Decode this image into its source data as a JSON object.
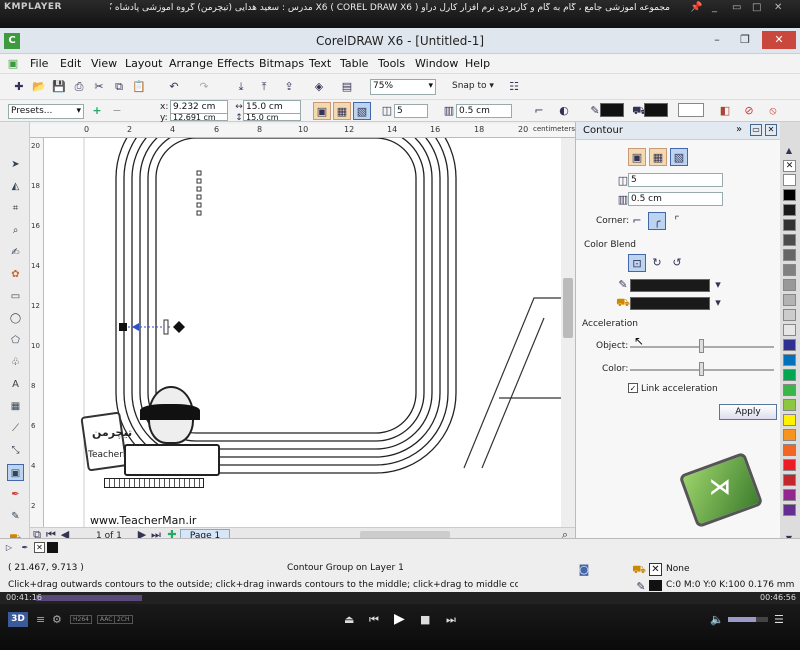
{
  "kmplayer": {
    "logo": "KMPLAYER",
    "title": "مجموعه آموزشی جامع ، گام به گام و کاربردی نرم افزار کارل دراو X6 ( COREL DRAW X6 ) مدرس : سعید هدایی (تیچرمن) گروه آموزشی پادشاه گرافیست ها",
    "time_elapsed": "00:41:16",
    "time_total": "00:46:56",
    "progress_fraction": 0.88,
    "badges": [
      "3D",
      "H264",
      "AAC",
      "2CH"
    ]
  },
  "app": {
    "title": "CorelDRAW X6 - [Untitled-1]",
    "window_buttons": [
      "–",
      "❐",
      "✕"
    ]
  },
  "menu": [
    "File",
    "Edit",
    "View",
    "Layout",
    "Arrange",
    "Effects",
    "Bitmaps",
    "Text",
    "Table",
    "Tools",
    "Window",
    "Help"
  ],
  "standard_toolbar": {
    "zoom": "75%",
    "snap_to": "Snap to"
  },
  "property_bar": {
    "presets": "Presets...",
    "x_label": "x:",
    "x": "9.232 cm",
    "y_label": "y:",
    "y": "12.691 cm",
    "width": "15.0 cm",
    "height": "15.0 cm",
    "steps": "5",
    "offset": "0.5 cm"
  },
  "ruler": {
    "top_ticks": [
      "0",
      "2",
      "4",
      "6",
      "8",
      "10",
      "12",
      "14",
      "16",
      "18",
      "20"
    ],
    "left_ticks": [
      "20",
      "18",
      "16",
      "14",
      "12",
      "10",
      "8",
      "6",
      "4",
      "2"
    ],
    "unit": "centimeters"
  },
  "canvas": {
    "watermark_brand": "TeacherMan",
    "watermark_brand_fa": "تیچرمن",
    "watermark_url": "www.TeacherMan.ir"
  },
  "page_nav": {
    "page_count": "1 of 1",
    "page_tab": "Page 1"
  },
  "docker": {
    "title": "Contour",
    "steps": "5",
    "offset": "0.5 cm",
    "corner_label": "Corner:",
    "color_blend_label": "Color Blend",
    "acceleration_label": "Acceleration",
    "object_label": "Object:",
    "color_label": "Color:",
    "link_acceleration": "Link acceleration",
    "link_acceleration_checked": true,
    "apply": "Apply"
  },
  "palette_colors": [
    "#ffffff",
    "#000000",
    "#1a1a1a",
    "#333333",
    "#4d4d4d",
    "#666666",
    "#808080",
    "#999999",
    "#b3b3b3",
    "#cccccc",
    "#e6e6e6",
    "#2e3192",
    "#0072bc",
    "#00a651",
    "#39b54a",
    "#8dc63f",
    "#fff200",
    "#f7941d",
    "#f26522",
    "#ed1c24",
    "#c1272d",
    "#92278f",
    "#662d91"
  ],
  "status": {
    "coordinates": "( 21.467, 9.713 )",
    "selection": "Contour Group on Layer 1",
    "hint": "Click+drag outwards contours to the outside; click+drag inwards contours to the middle; click+drag to middle contours to the center",
    "fill": "None",
    "outline": "C:0 M:0 Y:0 K:100  0.176 mm"
  }
}
